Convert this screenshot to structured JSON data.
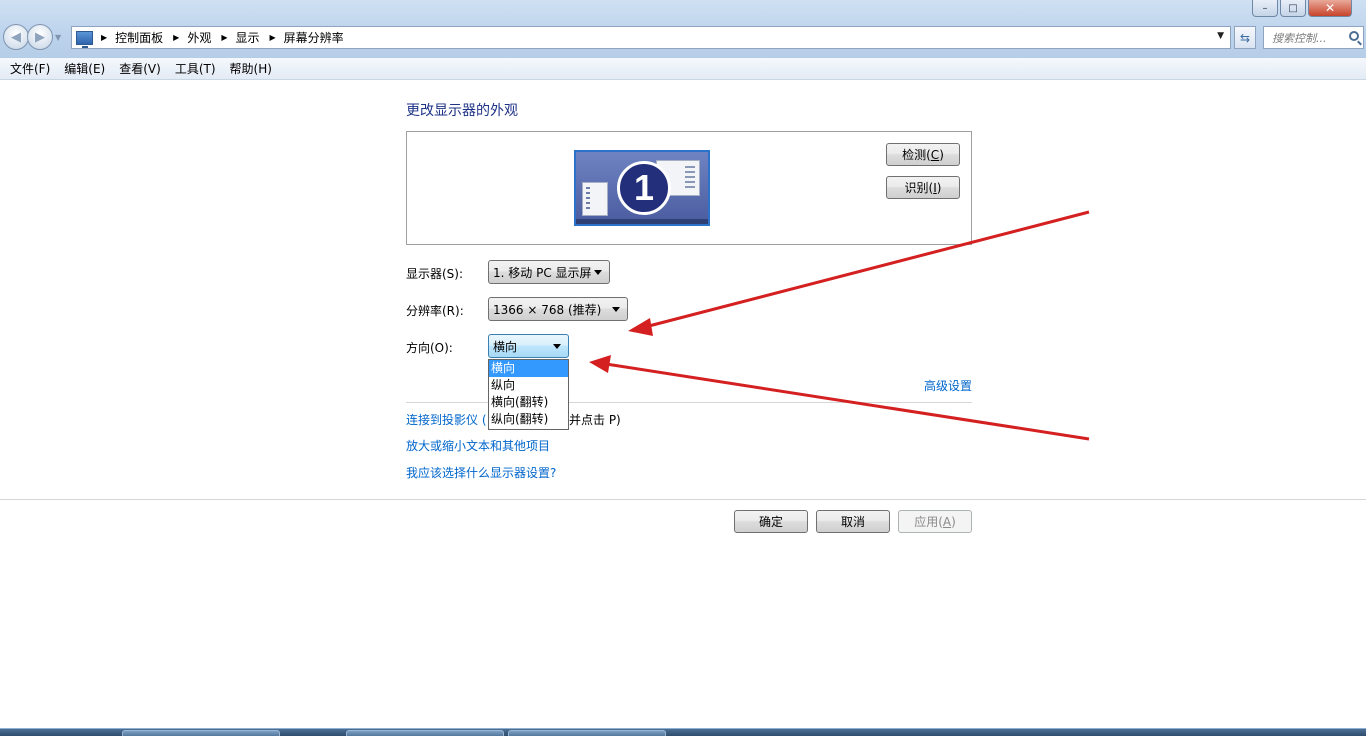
{
  "window": {
    "controls": {
      "minimize": "–",
      "maximize": "□",
      "close": "✕"
    }
  },
  "address": {
    "breadcrumbs": [
      "控制面板",
      "外观",
      "显示",
      "屏幕分辨率"
    ],
    "search_placeholder": "搜索控制..."
  },
  "menu": [
    "文件(F)",
    "编辑(E)",
    "查看(V)",
    "工具(T)",
    "帮助(H)"
  ],
  "main": {
    "heading": "更改显示器的外观",
    "monitor_number": "1",
    "detect_button": {
      "text": "检测(",
      "key": "C",
      "end": ")"
    },
    "identify_button": {
      "text": "识别(",
      "key": "I",
      "end": ")"
    },
    "display": {
      "label": "显示器(S):",
      "value": "1. 移动 PC 显示屏"
    },
    "resolution": {
      "label": "分辨率(R):",
      "value": "1366 × 768 (推荐)"
    },
    "orientation": {
      "label": "方向(O):",
      "value": "横向",
      "options": [
        "横向",
        "纵向",
        "横向(翻转)",
        "纵向(翻转)"
      ],
      "selected_index": 0
    },
    "advanced_link": "高级设置",
    "links": {
      "projector": "连接到投影仪 (",
      "projector_tail": "并点击 P)",
      "text_size": "放大或缩小文本和其他项目",
      "help": "我应该选择什么显示器设置?"
    }
  },
  "footer": {
    "ok": "确定",
    "cancel": "取消",
    "apply": {
      "text": "应用(",
      "key": "A",
      "end": ")"
    }
  },
  "colors": {
    "link": "#0066cc",
    "heading": "#1e3287",
    "selection": "#3399ff",
    "annotation_arrow": "#d42020"
  }
}
